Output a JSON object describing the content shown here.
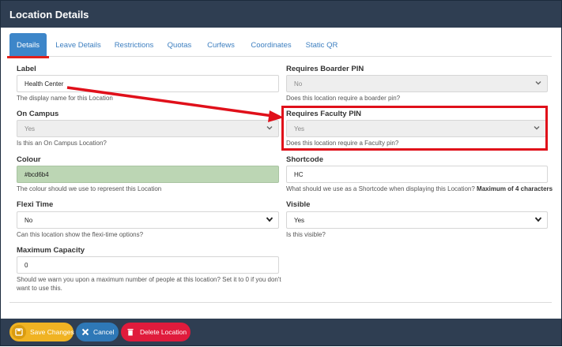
{
  "header": {
    "title": "Location Details"
  },
  "tabs": [
    {
      "label": "Details"
    },
    {
      "label": "Leave Details"
    },
    {
      "label": "Restrictions"
    },
    {
      "label": "Quotas"
    },
    {
      "label": "Curfews"
    },
    {
      "label": "Coordinates"
    },
    {
      "label": "Static QR"
    }
  ],
  "fields": {
    "label": {
      "label": "Label",
      "value": "Health Center",
      "help": "The display name for this Location"
    },
    "on_campus": {
      "label": "On Campus",
      "value": "Yes",
      "help": "Is this an On Campus Location?"
    },
    "colour": {
      "label": "Colour",
      "value": "#bcd6b4",
      "help": "The colour should we use to represent this Location"
    },
    "flexi_time": {
      "label": "Flexi Time",
      "value": "No",
      "help": "Can this location show the flexi-time options?"
    },
    "max_capacity": {
      "label": "Maximum Capacity",
      "value": "0",
      "help": "Should we warn you upon a maximum number of people at this location? Set it to 0 if you don't want to use this."
    },
    "boarder_pin": {
      "label": "Requires Boarder PIN",
      "value": "No",
      "help": "Does this location require a boarder pin?"
    },
    "faculty_pin": {
      "label": "Requires Faculty PIN",
      "value": "Yes",
      "help": "Does this location require a Faculty pin?"
    },
    "shortcode": {
      "label": "Shortcode",
      "value": "HC",
      "help": "What should we use as a Shortcode when displaying this Location?",
      "help_bold": "Maximum of 4 characters"
    },
    "visible": {
      "label": "Visible",
      "value": "Yes",
      "help": "Is this visible?"
    }
  },
  "footer": {
    "save_label": "Save Changes",
    "cancel_label": "Cancel",
    "delete_label": "Delete Location"
  },
  "colors": {
    "header_bg": "#2f3e52",
    "tab_active": "#3d86c9",
    "annotation_red": "#e0101a",
    "save": "#f0b323",
    "cancel": "#2e78b7",
    "delete": "#e01b3c"
  }
}
